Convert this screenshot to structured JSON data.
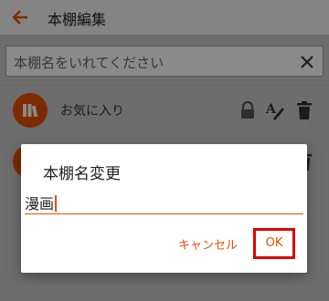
{
  "appbar": {
    "title": "本棚編集",
    "back_icon": "arrow-left-icon"
  },
  "search": {
    "placeholder": "本棚名をいれてください",
    "clear_icon": "close-icon"
  },
  "shelves": [
    {
      "label": "お気に入り",
      "icons": [
        "lock-icon",
        "rename-icon",
        "trash-icon"
      ]
    },
    {
      "label": "",
      "icons": [
        "trash-icon"
      ]
    }
  ],
  "dialog": {
    "title": "本棚名変更",
    "input_value": "漫画",
    "cancel_label": "キャンセル",
    "ok_label": "OK"
  },
  "colors": {
    "accent": "#e65100",
    "highlight": "#e00000"
  }
}
